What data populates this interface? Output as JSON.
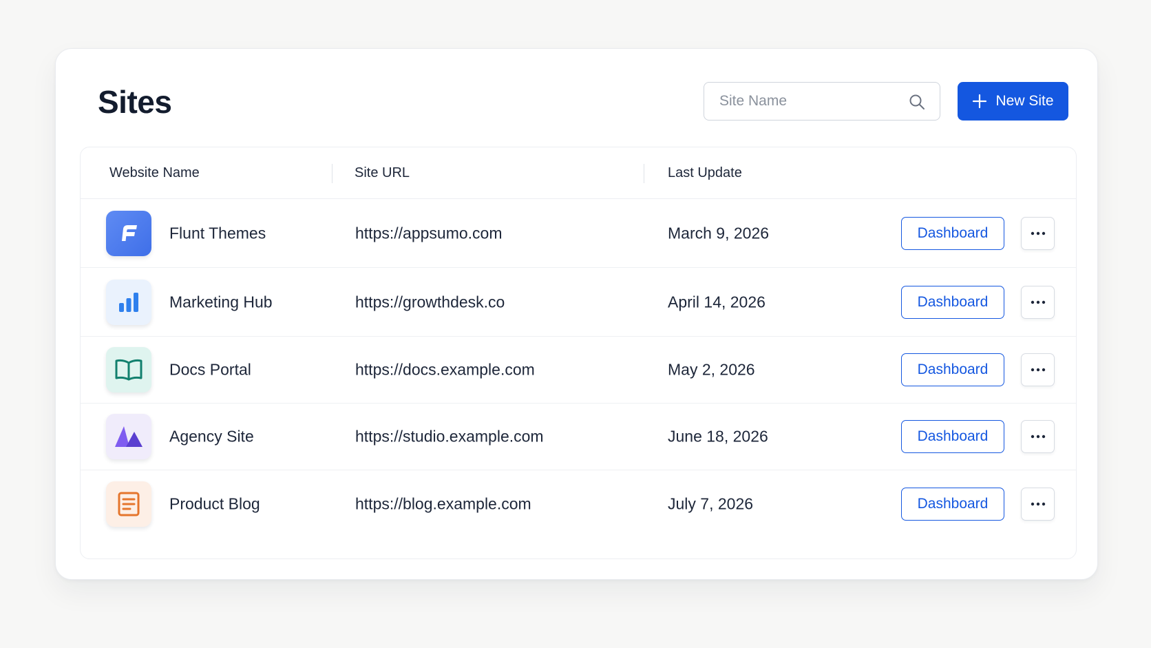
{
  "header": {
    "title": "Sites",
    "search_placeholder": "Site Name",
    "new_site_label": "New Site"
  },
  "table": {
    "columns": [
      "Website Name",
      "Site URL",
      "Last Update"
    ],
    "rows": [
      {
        "name": "Flunt Themes",
        "url": "https://appsumo.com",
        "updated": "March 9, 2026",
        "icon": "fluent-f-logo-icon",
        "dashboard_label": "Dashboard"
      },
      {
        "name": "Marketing Hub",
        "url": "https://growthdesk.co",
        "updated": "April 14, 2026",
        "icon": "bar-chart-icon",
        "dashboard_label": "Dashboard"
      },
      {
        "name": "Docs Portal",
        "url": "https://docs.example.com",
        "updated": "May 2, 2026",
        "icon": "open-book-icon",
        "dashboard_label": "Dashboard"
      },
      {
        "name": "Agency Site",
        "url": "https://studio.example.com",
        "updated": "June 18, 2026",
        "icon": "triangle-logo-icon",
        "dashboard_label": "Dashboard"
      },
      {
        "name": "Product Blog",
        "url": "https://blog.example.com",
        "updated": "July 7, 2026",
        "icon": "document-icon",
        "dashboard_label": "Dashboard"
      }
    ]
  },
  "colors": {
    "accent": "#1457e0",
    "title": "#131c2e",
    "fluent_icon_bg": "#4f7df0",
    "marketing_icon_bg": "#eaf2fd",
    "marketing_icon_fg": "#2f80ed",
    "docs_icon_bg": "#dff4ef",
    "docs_icon_fg": "#12806e",
    "agency_icon_bg": "#f0ecfb",
    "agency_icon_fg": "#6a4be0",
    "blog_icon_bg": "#fdefe6",
    "blog_icon_fg": "#e5752c"
  }
}
